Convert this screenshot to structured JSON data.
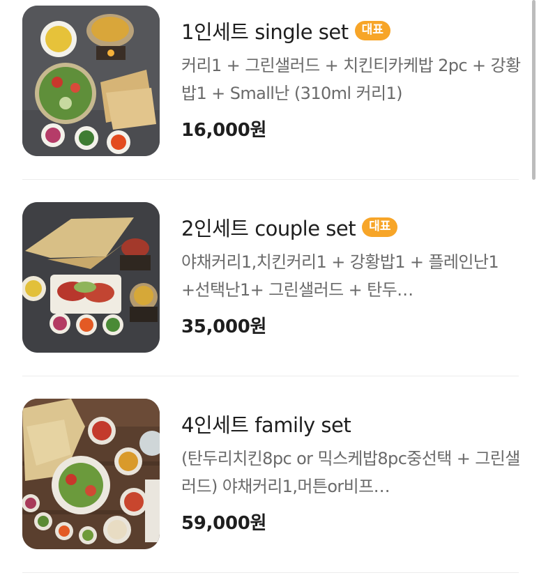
{
  "items": [
    {
      "title": "1인세트 single set",
      "badge": "대표",
      "description": "커리1 + 그린샐러드 + 치킨티카케밥 2pc + 강황밥1 + Small난 (310ml 커리1)",
      "price": "16,000원"
    },
    {
      "title": "2인세트 couple set",
      "badge": "대표",
      "description": "야채커리1,치킨커리1 + 강황밥1 + 플레인난1 +선택난1+ 그린샐러드 + 탄두…",
      "price": "35,000원"
    },
    {
      "title": "4인세트 family set",
      "badge": "",
      "description": "(탄두리치킨8pc or 믹스케밥8pc중선택 + 그린샐러드) 야채커리1,머튼or비프…",
      "price": "59,000원"
    }
  ],
  "colors": {
    "badge": "#f7a528",
    "title": "#1e1e1e",
    "description": "#6a6a6a",
    "divider": "#ececec"
  }
}
